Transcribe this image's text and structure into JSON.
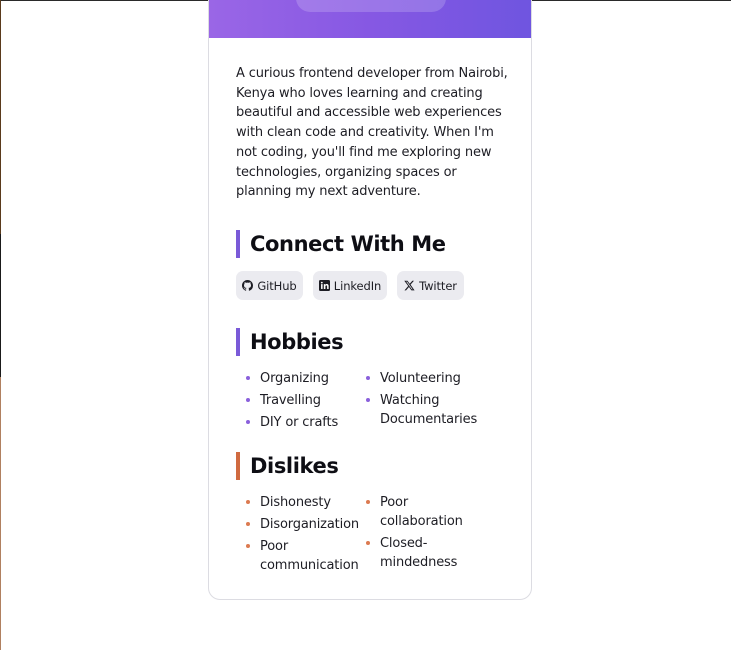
{
  "profile": {
    "bio": "A curious frontend developer from Nairobi, Kenya who loves learning and creating beautiful and accessible web experiences with clean code and creativity. When I'm not coding, you'll find me exploring new technologies, organizing spaces or planning my next adventure."
  },
  "connect": {
    "title": "Connect With Me",
    "links": [
      {
        "label": "GitHub",
        "icon": "github-icon"
      },
      {
        "label": "LinkedIn",
        "icon": "linkedin-icon"
      },
      {
        "label": "Twitter",
        "icon": "x-icon"
      }
    ]
  },
  "hobbies": {
    "title": "Hobbies",
    "column1": [
      "Organizing",
      "Travelling",
      "DIY or crafts"
    ],
    "column2": [
      "Volunteering",
      "Watching Documentaries"
    ]
  },
  "dislikes": {
    "title": "Dislikes",
    "column1": [
      "Dishonesty",
      "Disorganization",
      "Poor communication"
    ],
    "column2": [
      "Poor collaboration",
      "Closed-mindedness"
    ]
  },
  "colors": {
    "accent_purple": "#7a5ad8",
    "accent_orange": "#d06a40",
    "banner_start": "#9a66e6",
    "banner_end": "#6f55e0"
  }
}
